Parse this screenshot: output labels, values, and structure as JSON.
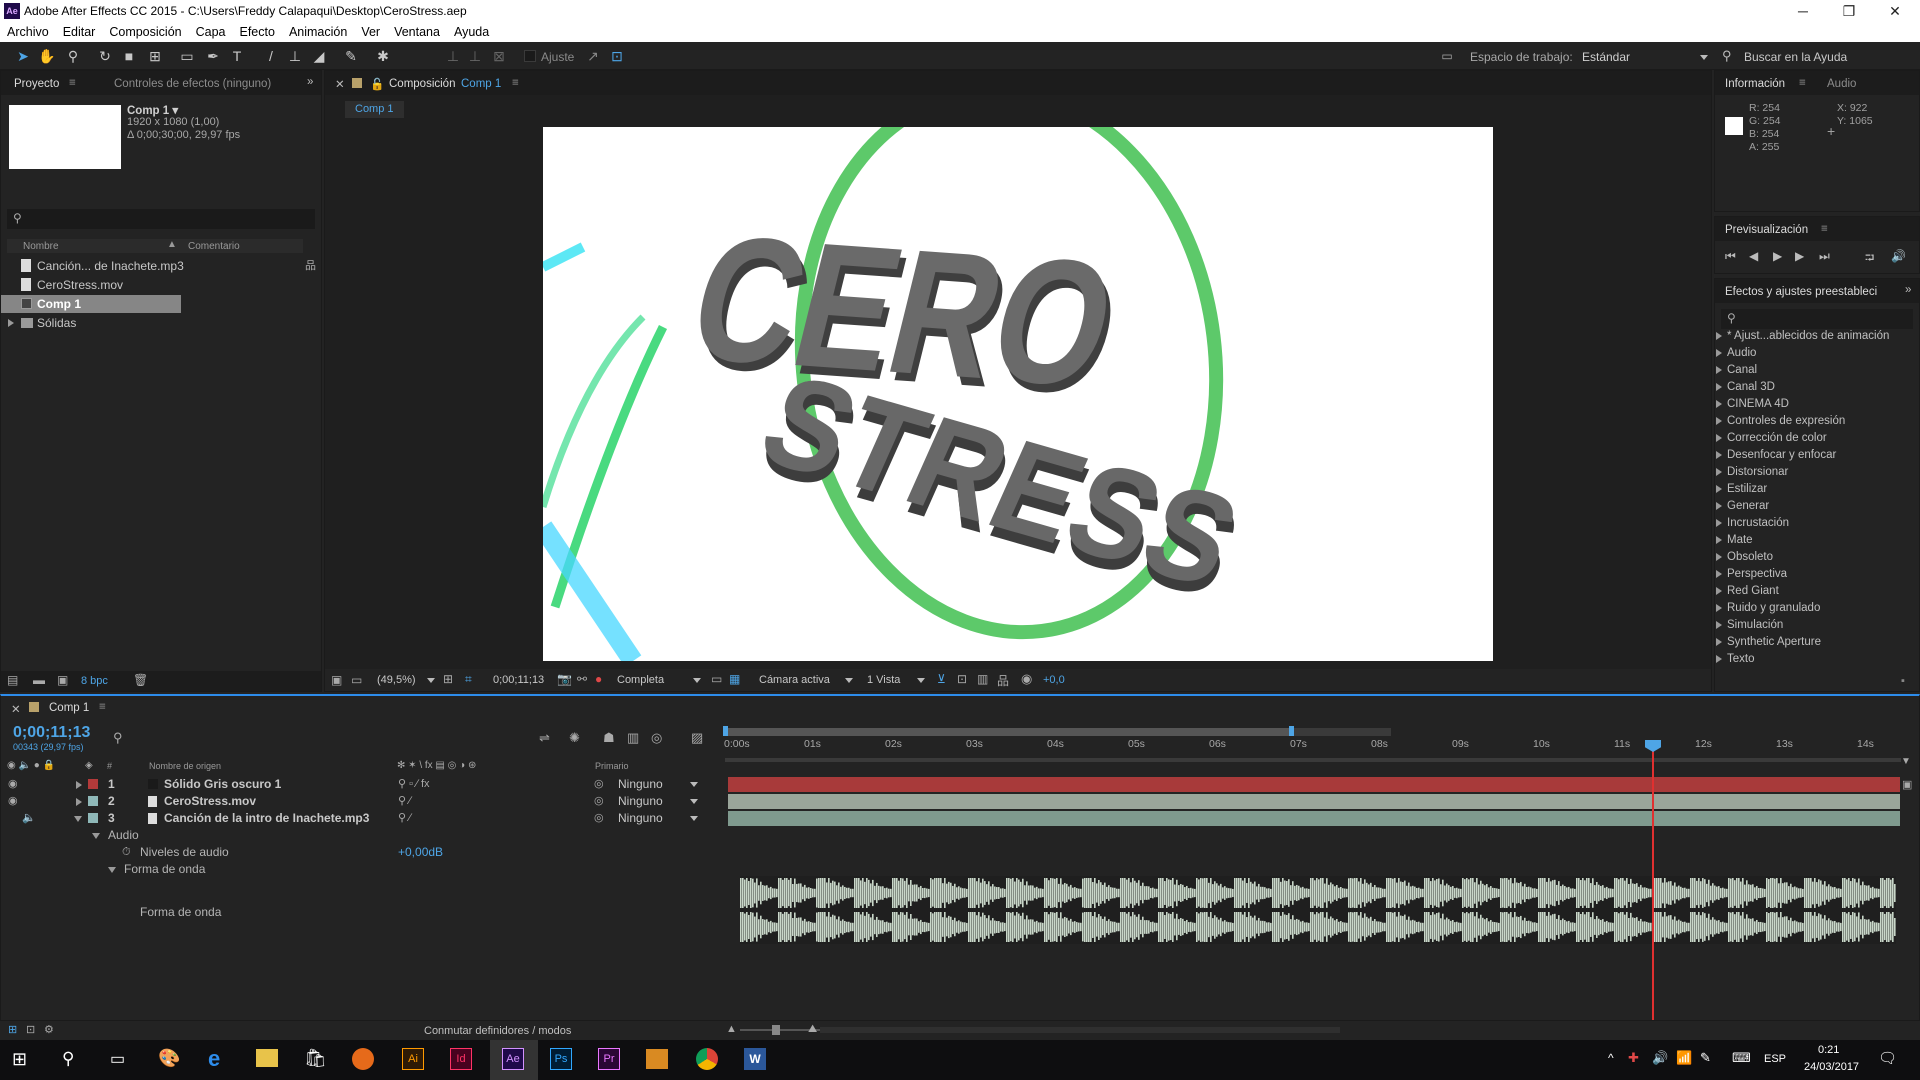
{
  "window": {
    "title": "Adobe After Effects CC 2015 - C:\\Users\\Freddy Calapaqui\\Desktop\\CeroStress.aep",
    "logo": "Ae"
  },
  "menu": [
    "Archivo",
    "Editar",
    "Composición",
    "Capa",
    "Efecto",
    "Animación",
    "Ver",
    "Ventana",
    "Ayuda"
  ],
  "toolbar": {
    "snap_label": "Ajuste",
    "workspace_label": "Espacio de trabajo:",
    "workspace_value": "Estándar",
    "help_search": "Buscar en la Ayuda"
  },
  "project": {
    "tab_project": "Proyecto",
    "tab_effects": "Controles de efectos (ninguno)",
    "comp_name": "Comp 1 ▾",
    "comp_res": "1920 x 1080 (1,00)",
    "comp_dur": "Δ 0;00;30;00, 29,97 fps",
    "col_name": "Nombre",
    "col_comment": "Comentario",
    "items": [
      "Canción... de Inachete.mp3",
      "CeroStress.mov",
      "Comp 1",
      "Sólidas"
    ],
    "bpc": "8 bpc"
  },
  "composition": {
    "tab_label": "Composición",
    "tab_comp": "Comp 1",
    "subtab": "Comp 1",
    "zoom": "(49,5%)",
    "timecode": "0;00;11;13",
    "resolution": "Completa",
    "camera": "Cámara activa",
    "views": "1 Vista",
    "exposure": "+0,0",
    "logo_line1": "CERO",
    "logo_line2": "STRESS"
  },
  "info": {
    "tab_info": "Información",
    "tab_audio": "Audio",
    "r": "R:  254",
    "g": "G:  254",
    "b": "B:  254",
    "a": "A:  255",
    "x": "X:  922",
    "y": "Y:  1065"
  },
  "preview": {
    "title": "Previsualización"
  },
  "effects": {
    "title": "Efectos y ajustes preestableci",
    "items": [
      "* Ajust...ablecidos de animación",
      "Audio",
      "Canal",
      "Canal 3D",
      "CINEMA 4D",
      "Controles de expresión",
      "Corrección de color",
      "Desenfocar y enfocar",
      "Distorsionar",
      "Estilizar",
      "Generar",
      "Incrustación",
      "Mate",
      "Obsoleto",
      "Perspectiva",
      "Red Giant",
      "Ruido y granulado",
      "Simulación",
      "Synthetic Aperture",
      "Texto"
    ]
  },
  "timeline": {
    "tab": "Comp 1",
    "timecode": "0;00;11;13",
    "frames": "00343 (29,97 fps)",
    "col_num": "#",
    "col_name": "Nombre de origen",
    "col_parent": "Primario",
    "ticks": [
      "0:00s",
      "01s",
      "02s",
      "03s",
      "04s",
      "05s",
      "06s",
      "07s",
      "08s",
      "09s",
      "10s",
      "11s",
      "12s",
      "13s",
      "14s"
    ],
    "layers": [
      {
        "num": "1",
        "name": "Sólido Gris oscuro 1",
        "parent": "Ninguno",
        "color": "#b33a3a"
      },
      {
        "num": "2",
        "name": "CeroStress.mov",
        "parent": "Ninguno",
        "color": "#8fb8b8"
      },
      {
        "num": "3",
        "name": "Canción de la intro de Inachete.mp3",
        "parent": "Ninguno",
        "color": "#8fb8b8"
      }
    ],
    "audio_group": "Audio",
    "audio_levels_label": "Niveles de audio",
    "audio_levels_value": "+0,00dB",
    "waveform_group": "Forma de onda",
    "waveform_label": "Forma de onda",
    "toggle_label": "Conmutar definidores / modos",
    "playhead_seconds": 11.44
  },
  "taskbar": {
    "lang": "ESP",
    "time": "0:21",
    "date": "24/03/2017",
    "apps": [
      "Ai",
      "Id",
      "Ae",
      "Ps",
      "Pr",
      "W"
    ]
  }
}
